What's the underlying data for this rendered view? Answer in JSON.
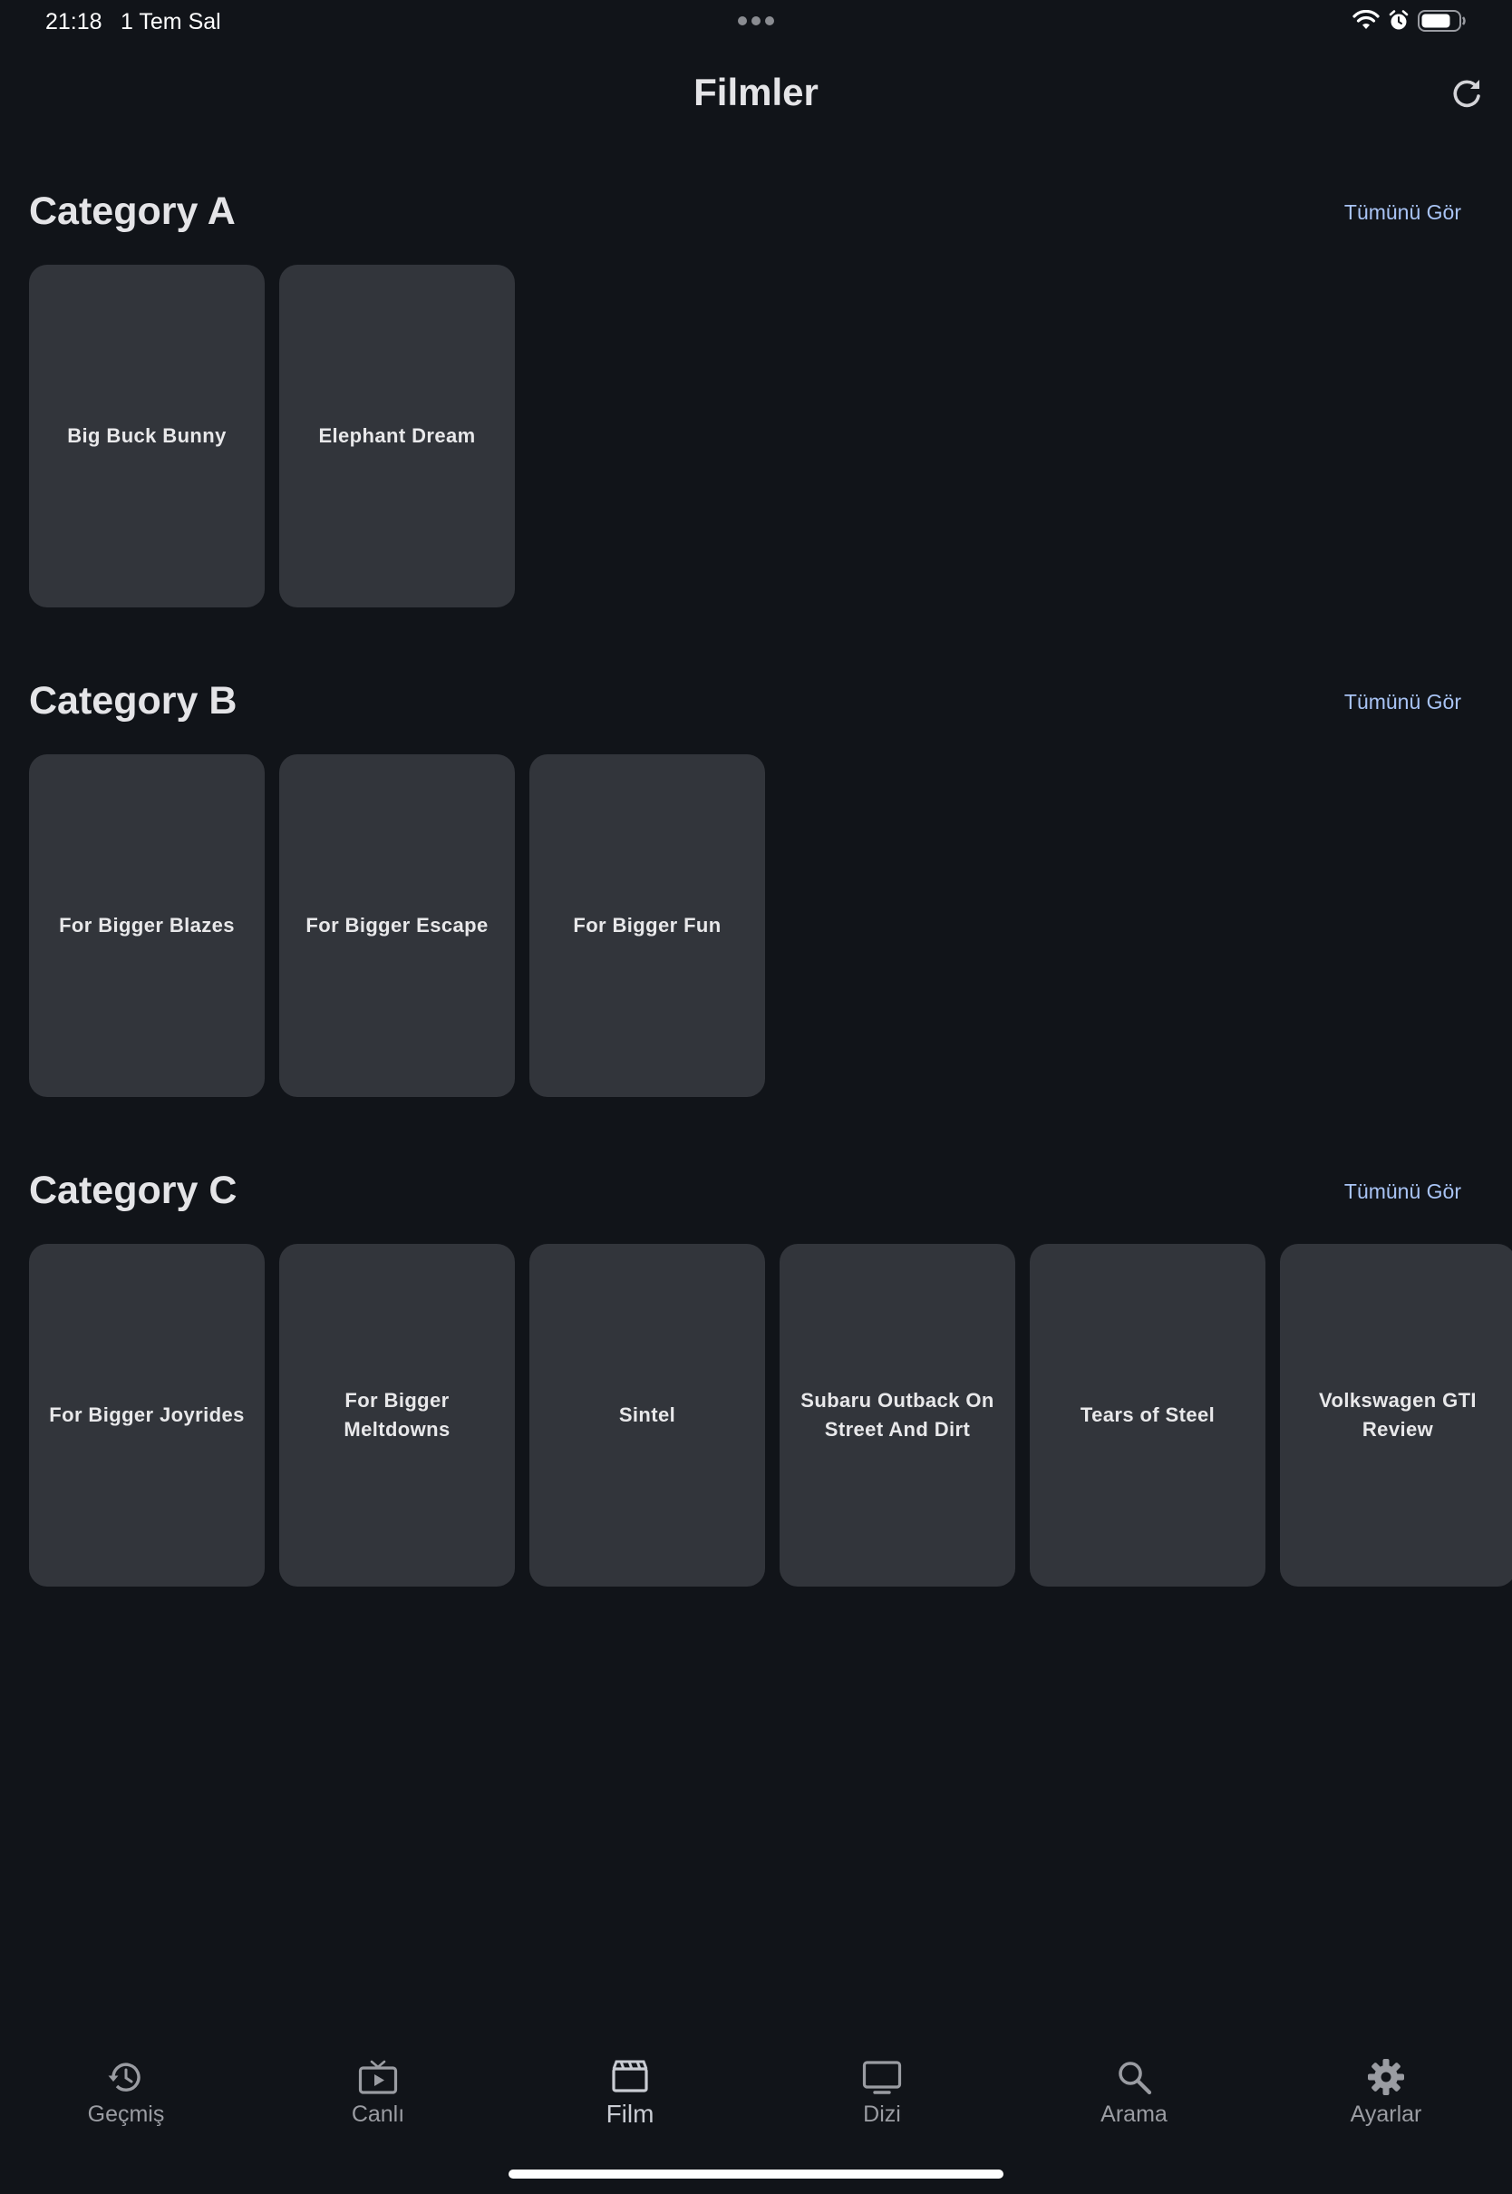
{
  "status_bar": {
    "time": "21:18",
    "date": "1 Tem Sal"
  },
  "header": {
    "title": "Filmler"
  },
  "categories": [
    {
      "title": "Category A",
      "see_all": "Tümünü Gör",
      "items": [
        "Big Buck Bunny",
        "Elephant Dream"
      ]
    },
    {
      "title": "Category B",
      "see_all": "Tümünü Gör",
      "items": [
        "For Bigger Blazes",
        "For Bigger Escape",
        "For Bigger Fun"
      ]
    },
    {
      "title": "Category C",
      "see_all": "Tümünü Gör",
      "items": [
        "For Bigger Joyrides",
        "For Bigger Meltdowns",
        "Sintel",
        "Subaru Outback On Street And Dirt",
        "Tears of Steel",
        "Volkswagen GTI Review"
      ]
    }
  ],
  "nav": {
    "items": [
      {
        "label": "Geçmiş",
        "icon": "history-icon"
      },
      {
        "label": "Canlı",
        "icon": "live-tv-icon"
      },
      {
        "label": "Film",
        "icon": "movie-icon"
      },
      {
        "label": "Dizi",
        "icon": "tv-icon"
      },
      {
        "label": "Arama",
        "icon": "search-icon"
      },
      {
        "label": "Ayarlar",
        "icon": "settings-icon"
      }
    ],
    "active_index": 2
  },
  "colors": {
    "background": "#111419",
    "card": "#32353b",
    "link": "#a9c4f5",
    "nav_inactive": "#9a9ca2"
  }
}
